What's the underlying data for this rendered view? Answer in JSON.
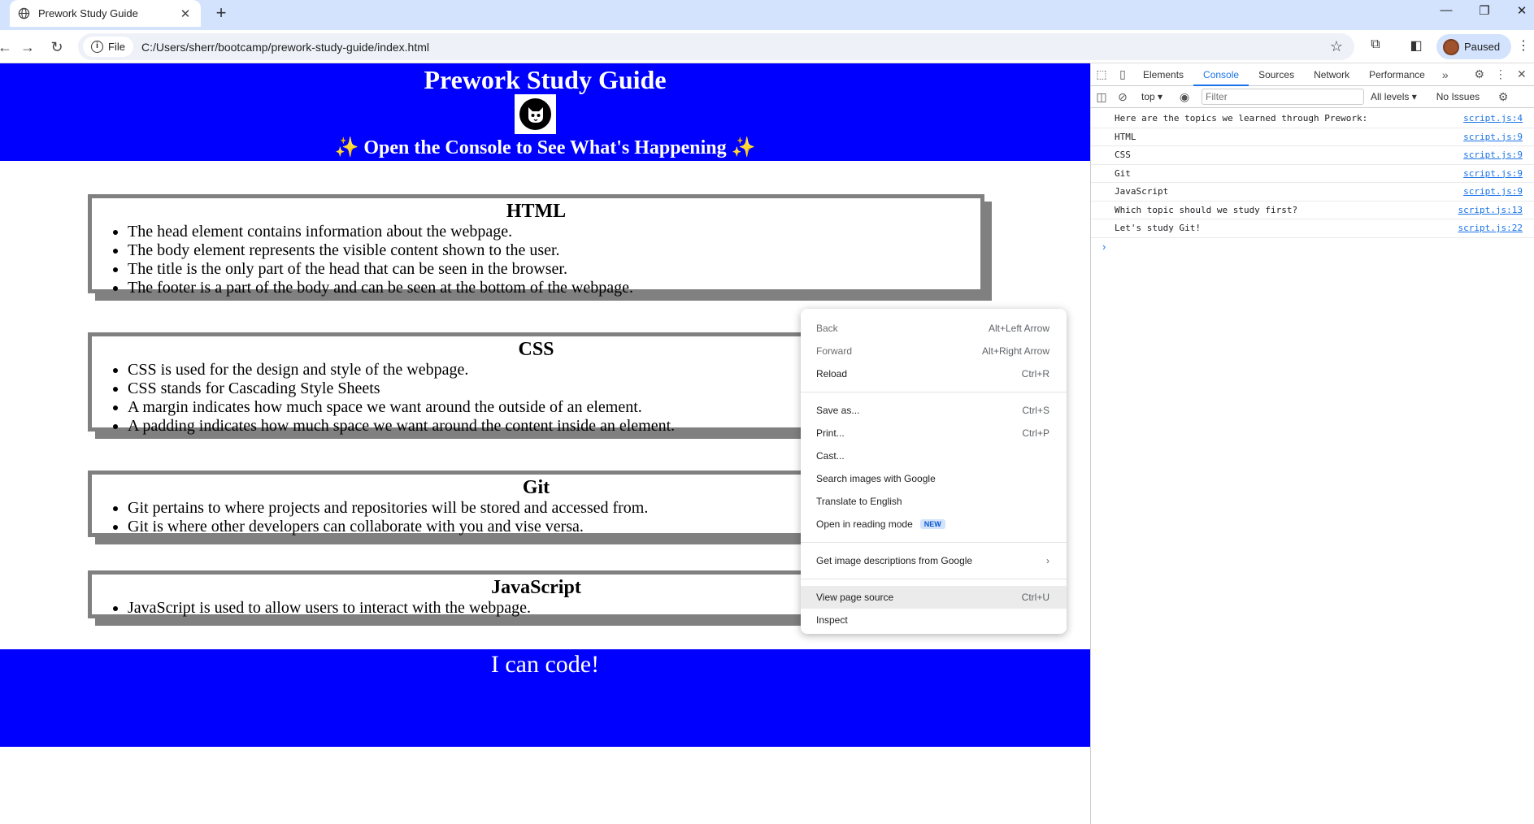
{
  "browser": {
    "tab_title": "Prework Study Guide",
    "chip_label": "File",
    "url": "C:/Users/sherr/bootcamp/prework-study-guide/index.html",
    "profile_status": "Paused"
  },
  "page": {
    "title": "Prework Study Guide",
    "subtitle": "✨ Open the Console to See What's Happening ✨",
    "footer": "I can code!",
    "sections": [
      {
        "heading": "HTML",
        "items": [
          "The head element contains information about the webpage.",
          "The body element represents the visible content shown to the user.",
          "The title is the only part of the head that can be seen in the browser.",
          "The footer is a part of the body and can be seen at the bottom of the webpage."
        ]
      },
      {
        "heading": "CSS",
        "items": [
          "CSS is used for the design and style of the webpage.",
          "CSS stands for Cascading Style Sheets",
          "A margin indicates how much space we want around the outside of an element.",
          "A padding indicates how much space we want around the content inside an element."
        ]
      },
      {
        "heading": "Git",
        "items": [
          "Git pertains to where projects and repositories will be stored and accessed from.",
          "Git is where other developers can collaborate with you and vise versa."
        ]
      },
      {
        "heading": "JavaScript",
        "items": [
          "JavaScript is used to allow users to interact with the webpage."
        ]
      }
    ]
  },
  "devtools": {
    "tabs": [
      "Elements",
      "Console",
      "Sources",
      "Network",
      "Performance"
    ],
    "active_tab": "Console",
    "context": "top",
    "filter_placeholder": "Filter",
    "levels": "All levels",
    "issues": "No Issues",
    "console_lines": [
      {
        "msg": "Here are the topics we learned through Prework:",
        "src": "script.js:4"
      },
      {
        "msg": "HTML",
        "src": "script.js:9"
      },
      {
        "msg": "CSS",
        "src": "script.js:9"
      },
      {
        "msg": "Git",
        "src": "script.js:9"
      },
      {
        "msg": "JavaScript",
        "src": "script.js:9"
      },
      {
        "msg": "Which topic should we study first?",
        "src": "script.js:13"
      },
      {
        "msg": "Let's study Git!",
        "src": "script.js:22"
      }
    ]
  },
  "context_menu": {
    "back": {
      "label": "Back",
      "shortcut": "Alt+Left Arrow"
    },
    "forward": {
      "label": "Forward",
      "shortcut": "Alt+Right Arrow"
    },
    "reload": {
      "label": "Reload",
      "shortcut": "Ctrl+R"
    },
    "save_as": {
      "label": "Save as...",
      "shortcut": "Ctrl+S"
    },
    "print": {
      "label": "Print...",
      "shortcut": "Ctrl+P"
    },
    "cast": {
      "label": "Cast..."
    },
    "search_images": {
      "label": "Search images with Google"
    },
    "translate": {
      "label": "Translate to English"
    },
    "reading_mode": {
      "label": "Open in reading mode",
      "badge": "NEW"
    },
    "image_descriptions": {
      "label": "Get image descriptions from Google"
    },
    "view_source": {
      "label": "View page source",
      "shortcut": "Ctrl+U"
    },
    "inspect": {
      "label": "Inspect"
    }
  }
}
